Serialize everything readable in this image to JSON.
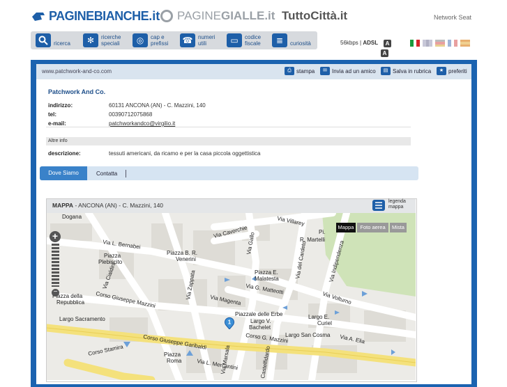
{
  "header": {
    "brand1_a": "PAGINE",
    "brand1_b": "BIANCHE",
    "brand1_c": ".it",
    "brand2_a": "PAGINE",
    "brand2_b": "GIALLE",
    "brand2_c": ".it",
    "brand3": "TuttoCittà.it",
    "network_seat": "Network Seat"
  },
  "toolbar": {
    "items": [
      {
        "label": "ricerca",
        "icon": "search-icon"
      },
      {
        "label": "ricerche\nspeciali",
        "icon": "gear-icon"
      },
      {
        "label": "cap e\nprefissi",
        "icon": "globe-icon"
      },
      {
        "label": "numeri\nutili",
        "icon": "phone-icon"
      },
      {
        "label": "codice\nfiscale",
        "icon": "card-icon"
      },
      {
        "label": "curiosità",
        "icon": "book-icon"
      }
    ],
    "speed": "56kbps",
    "adsl": "ADSL",
    "badge": "A",
    "badge2": "A"
  },
  "flags": [
    {
      "name": "italian-flag",
      "colors": [
        "#1a9a3c",
        "#ffffff",
        "#d6262b"
      ]
    },
    {
      "name": "english-flag",
      "colors": [
        "#c8c8d8",
        "#b0b0c4",
        "#c8c8d8"
      ]
    },
    {
      "name": "german-flag",
      "colors": [
        "#d99a9a",
        "#e8a0a0",
        "#e8d090"
      ]
    },
    {
      "name": "french-flag",
      "colors": [
        "#9fb5d8",
        "#ffffff",
        "#e8a0a0"
      ]
    },
    {
      "name": "spanish-flag",
      "colors": [
        "#e8b070",
        "#f0d090",
        "#e8b070"
      ]
    }
  ],
  "page": {
    "url": "www.patchwork-and-co.com",
    "actions": [
      {
        "label": "stampa",
        "icon": "printer-icon"
      },
      {
        "label": "Invia ad un amico",
        "icon": "mail-icon"
      },
      {
        "label": "Salva in rubrica",
        "icon": "folder-icon"
      },
      {
        "label": "preferiti",
        "icon": "star-icon"
      }
    ],
    "business_name": "Patchwork And Co.",
    "fields": [
      {
        "label": "indirizzo:",
        "value": "60131 ANCONA (AN) - C. Mazzini, 140"
      },
      {
        "label": "tel:",
        "value": "00390712075868"
      },
      {
        "label": "e-mail:",
        "value": "patchworkandco@virgilio.it"
      }
    ],
    "altre_info": "Altre info",
    "descrizione_label": "descrizione:",
    "descrizione_value": "tessuti americani, da ricamo e per la casa piccola oggettistica",
    "tabs": [
      "Dove Siamo",
      "Contatta"
    ]
  },
  "map": {
    "title_bold": "MAPPA",
    "title_rest": " - ANCONA (AN) - C. Mazzini, 140",
    "legend": "legenda\nmappa",
    "map_types": [
      "Mappa",
      "Foto aerea",
      "Mista"
    ],
    "marker_label": "1",
    "streets": [
      "Dogana",
      "Via L. Bernabei",
      "Piazza Plebiscito",
      "Via Cavorchie",
      "Via Villarey",
      "Pi. R. Martelli",
      "Piazza B. R. Venerini",
      "Piazza E. Malatesta",
      "Via G. Matteotti",
      "Via Volturno",
      "Via Magenta",
      "Piazzale delle Erbe",
      "Largo V. Bachelet",
      "Largo E. Curiel",
      "Largo San Cosma",
      "Via A. Elia",
      "Corso Giuseppe Mazzini",
      "Corso Giuseppe Garibaldi",
      "Piazza Roma",
      "Corso Stamira",
      "Largo Sacramento",
      "Piazza della Repubblica",
      "Via Gallo",
      "Via del Cardeto",
      "Via Indipendenza",
      "Via Zappata",
      "Via Cialdini",
      "Via L. Mercantini",
      "Via Marsala",
      "Castelfidardo"
    ]
  }
}
